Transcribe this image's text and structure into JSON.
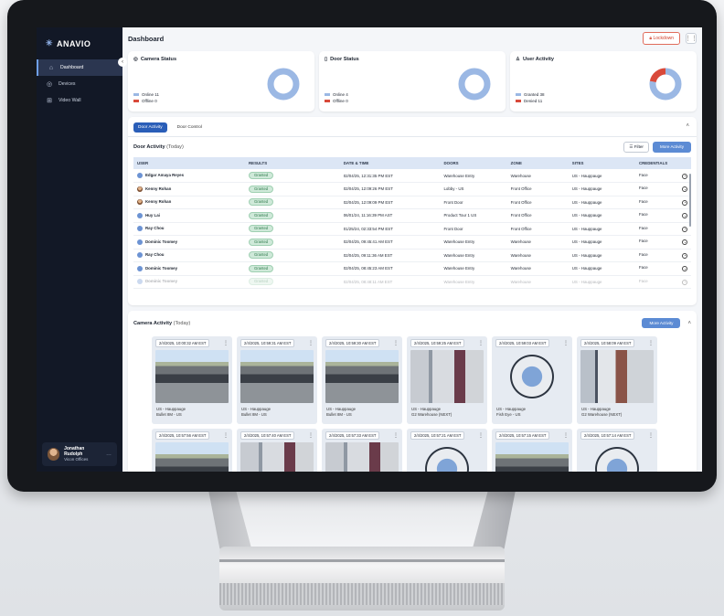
{
  "app": {
    "logo": "ANAVIO",
    "page_title": "Dashboard"
  },
  "sidebar": {
    "items": [
      {
        "label": "Dashboard",
        "icon": "home-icon"
      },
      {
        "label": "Devices",
        "icon": "camera-icon"
      },
      {
        "label": "Video Wall",
        "icon": "grid-icon"
      }
    ],
    "user": {
      "name": "Jonathan Rudolph",
      "org": "Vicon Offices"
    }
  },
  "header": {
    "lockdown_label": "Lockdown"
  },
  "cards": {
    "camera": {
      "title": "Camera Status",
      "legend": [
        {
          "label": "Online",
          "value": "11",
          "color": "#9bb8e4"
        },
        {
          "label": "Offline",
          "value": "0",
          "color": "#d9493a"
        }
      ],
      "fractions": [
        1.0,
        0.0
      ]
    },
    "door": {
      "title": "Door Status",
      "legend": [
        {
          "label": "Online",
          "value": "4",
          "color": "#9bb8e4"
        },
        {
          "label": "Offline",
          "value": "0",
          "color": "#d9493a"
        }
      ],
      "fractions": [
        1.0,
        0.0
      ]
    },
    "user": {
      "title": "User Activity",
      "legend": [
        {
          "label": "Granted",
          "value": "38",
          "color": "#9bb8e4"
        },
        {
          "label": "Denied",
          "value": "11",
          "color": "#d9493a"
        }
      ],
      "fractions": [
        0.78,
        0.22
      ]
    }
  },
  "door_panel": {
    "tabs": [
      "Door Activity",
      "Door Control"
    ],
    "title": "Door Activity",
    "subtitle": "(Today)",
    "filter_label": "Filter",
    "more_label": "More Activity",
    "columns": [
      "USER",
      "RESULTS",
      "DATE & TIME",
      "DOORS",
      "ZONE",
      "SITES",
      "CREDENTIALS"
    ],
    "rows": [
      {
        "user": "Edgar Amaya Reyes",
        "avatar": "initials",
        "result": "Granted",
        "datetime": "02/04/25, 12:31:35 PM EST",
        "door": "Warehouse Entry",
        "zone": "Warehouse",
        "site": "US - Hauppauge",
        "credential": "Face"
      },
      {
        "user": "Kenny Rohan",
        "avatar": "photo",
        "result": "Granted",
        "datetime": "02/04/25, 12:09:26 PM EST",
        "door": "Lobby - US",
        "zone": "Front Office",
        "site": "US - Hauppauge",
        "credential": "Face"
      },
      {
        "user": "Kenny Rohan",
        "avatar": "photo",
        "result": "Granted",
        "datetime": "02/04/25, 12:09:09 PM EST",
        "door": "Front Door",
        "zone": "Front Office",
        "site": "US - Hauppauge",
        "credential": "Face"
      },
      {
        "user": "Huy Lai",
        "avatar": "initials",
        "result": "Granted",
        "datetime": "06/01/24, 11:16:39 PM AST",
        "door": "Product Tour 1 US",
        "zone": "Front Office",
        "site": "US - Hauppauge",
        "credential": "Face"
      },
      {
        "user": "Ray Chou",
        "avatar": "initials",
        "result": "Granted",
        "datetime": "01/25/24, 02:33:54 PM EST",
        "door": "Front Door",
        "zone": "Front Office",
        "site": "US - Hauppauge",
        "credential": "Face"
      },
      {
        "user": "Dominic Toomey",
        "avatar": "initials",
        "result": "Granted",
        "datetime": "02/04/25, 09:45:41 AM EST",
        "door": "Warehouse Entry",
        "zone": "Warehouse",
        "site": "US - Hauppauge",
        "credential": "Face"
      },
      {
        "user": "Ray Chou",
        "avatar": "initials",
        "result": "Granted",
        "datetime": "02/04/25, 09:11:36 AM EST",
        "door": "Warehouse Entry",
        "zone": "Warehouse",
        "site": "US - Hauppauge",
        "credential": "Face"
      },
      {
        "user": "Dominic Toomey",
        "avatar": "initials",
        "result": "Granted",
        "datetime": "02/04/25, 08:45:23 AM EST",
        "door": "Warehouse Entry",
        "zone": "Warehouse",
        "site": "US - Hauppauge",
        "credential": "Face"
      },
      {
        "user": "Dominic Toomey",
        "avatar": "initials",
        "result": "Granted",
        "datetime": "02/04/25, 08:48:11 AM EST",
        "door": "Warehouse Entry",
        "zone": "Warehouse",
        "site": "US - Hauppauge",
        "credential": "Face"
      }
    ]
  },
  "camera_panel": {
    "title": "Camera Activity",
    "subtitle": "(Today)",
    "more_label": "More Activity",
    "tiles": [
      {
        "time": "2/4/2025, 10:00:32 AM EST",
        "site": "US - Hauppauge",
        "camera": "Bullet 8M - US",
        "scene": "parking"
      },
      {
        "time": "2/4/2025, 10:59:31 AM EST",
        "site": "US - Hauppauge",
        "camera": "Bullet 8M - US",
        "scene": "parking"
      },
      {
        "time": "2/4/2025, 10:59:30 AM EST",
        "site": "US - Hauppauge",
        "camera": "Bullet 8M - US",
        "scene": "parking"
      },
      {
        "time": "2/4/2025, 10:59:25 AM EST",
        "site": "US - Hauppauge",
        "camera": "G2 Warehouse (NEXT)",
        "scene": "warehouse"
      },
      {
        "time": "2/4/2025, 10:59:03 AM EST",
        "site": "US - Hauppauge",
        "camera": "Fish Eye - US",
        "scene": "fisheye"
      },
      {
        "time": "2/4/2025, 10:58:09 AM EST",
        "site": "US - Hauppauge",
        "camera": "G2 Warehouse (NEXT)",
        "scene": "storage"
      },
      {
        "time": "2/4/2025, 10:57:56 AM EST",
        "site": "",
        "camera": "",
        "scene": "parking"
      },
      {
        "time": "2/4/2025, 10:57:40 AM EST",
        "site": "",
        "camera": "",
        "scene": "warehouse"
      },
      {
        "time": "2/4/2025, 10:57:33 AM EST",
        "site": "",
        "camera": "",
        "scene": "warehouse"
      },
      {
        "time": "2/4/2025, 10:57:21 AM EST",
        "site": "",
        "camera": "",
        "scene": "fisheye"
      },
      {
        "time": "2/4/2025, 10:57:15 AM EST",
        "site": "",
        "camera": "",
        "scene": "parking"
      },
      {
        "time": "2/4/2025, 10:57:14 AM EST",
        "site": "",
        "camera": "",
        "scene": "fisheye"
      }
    ]
  }
}
